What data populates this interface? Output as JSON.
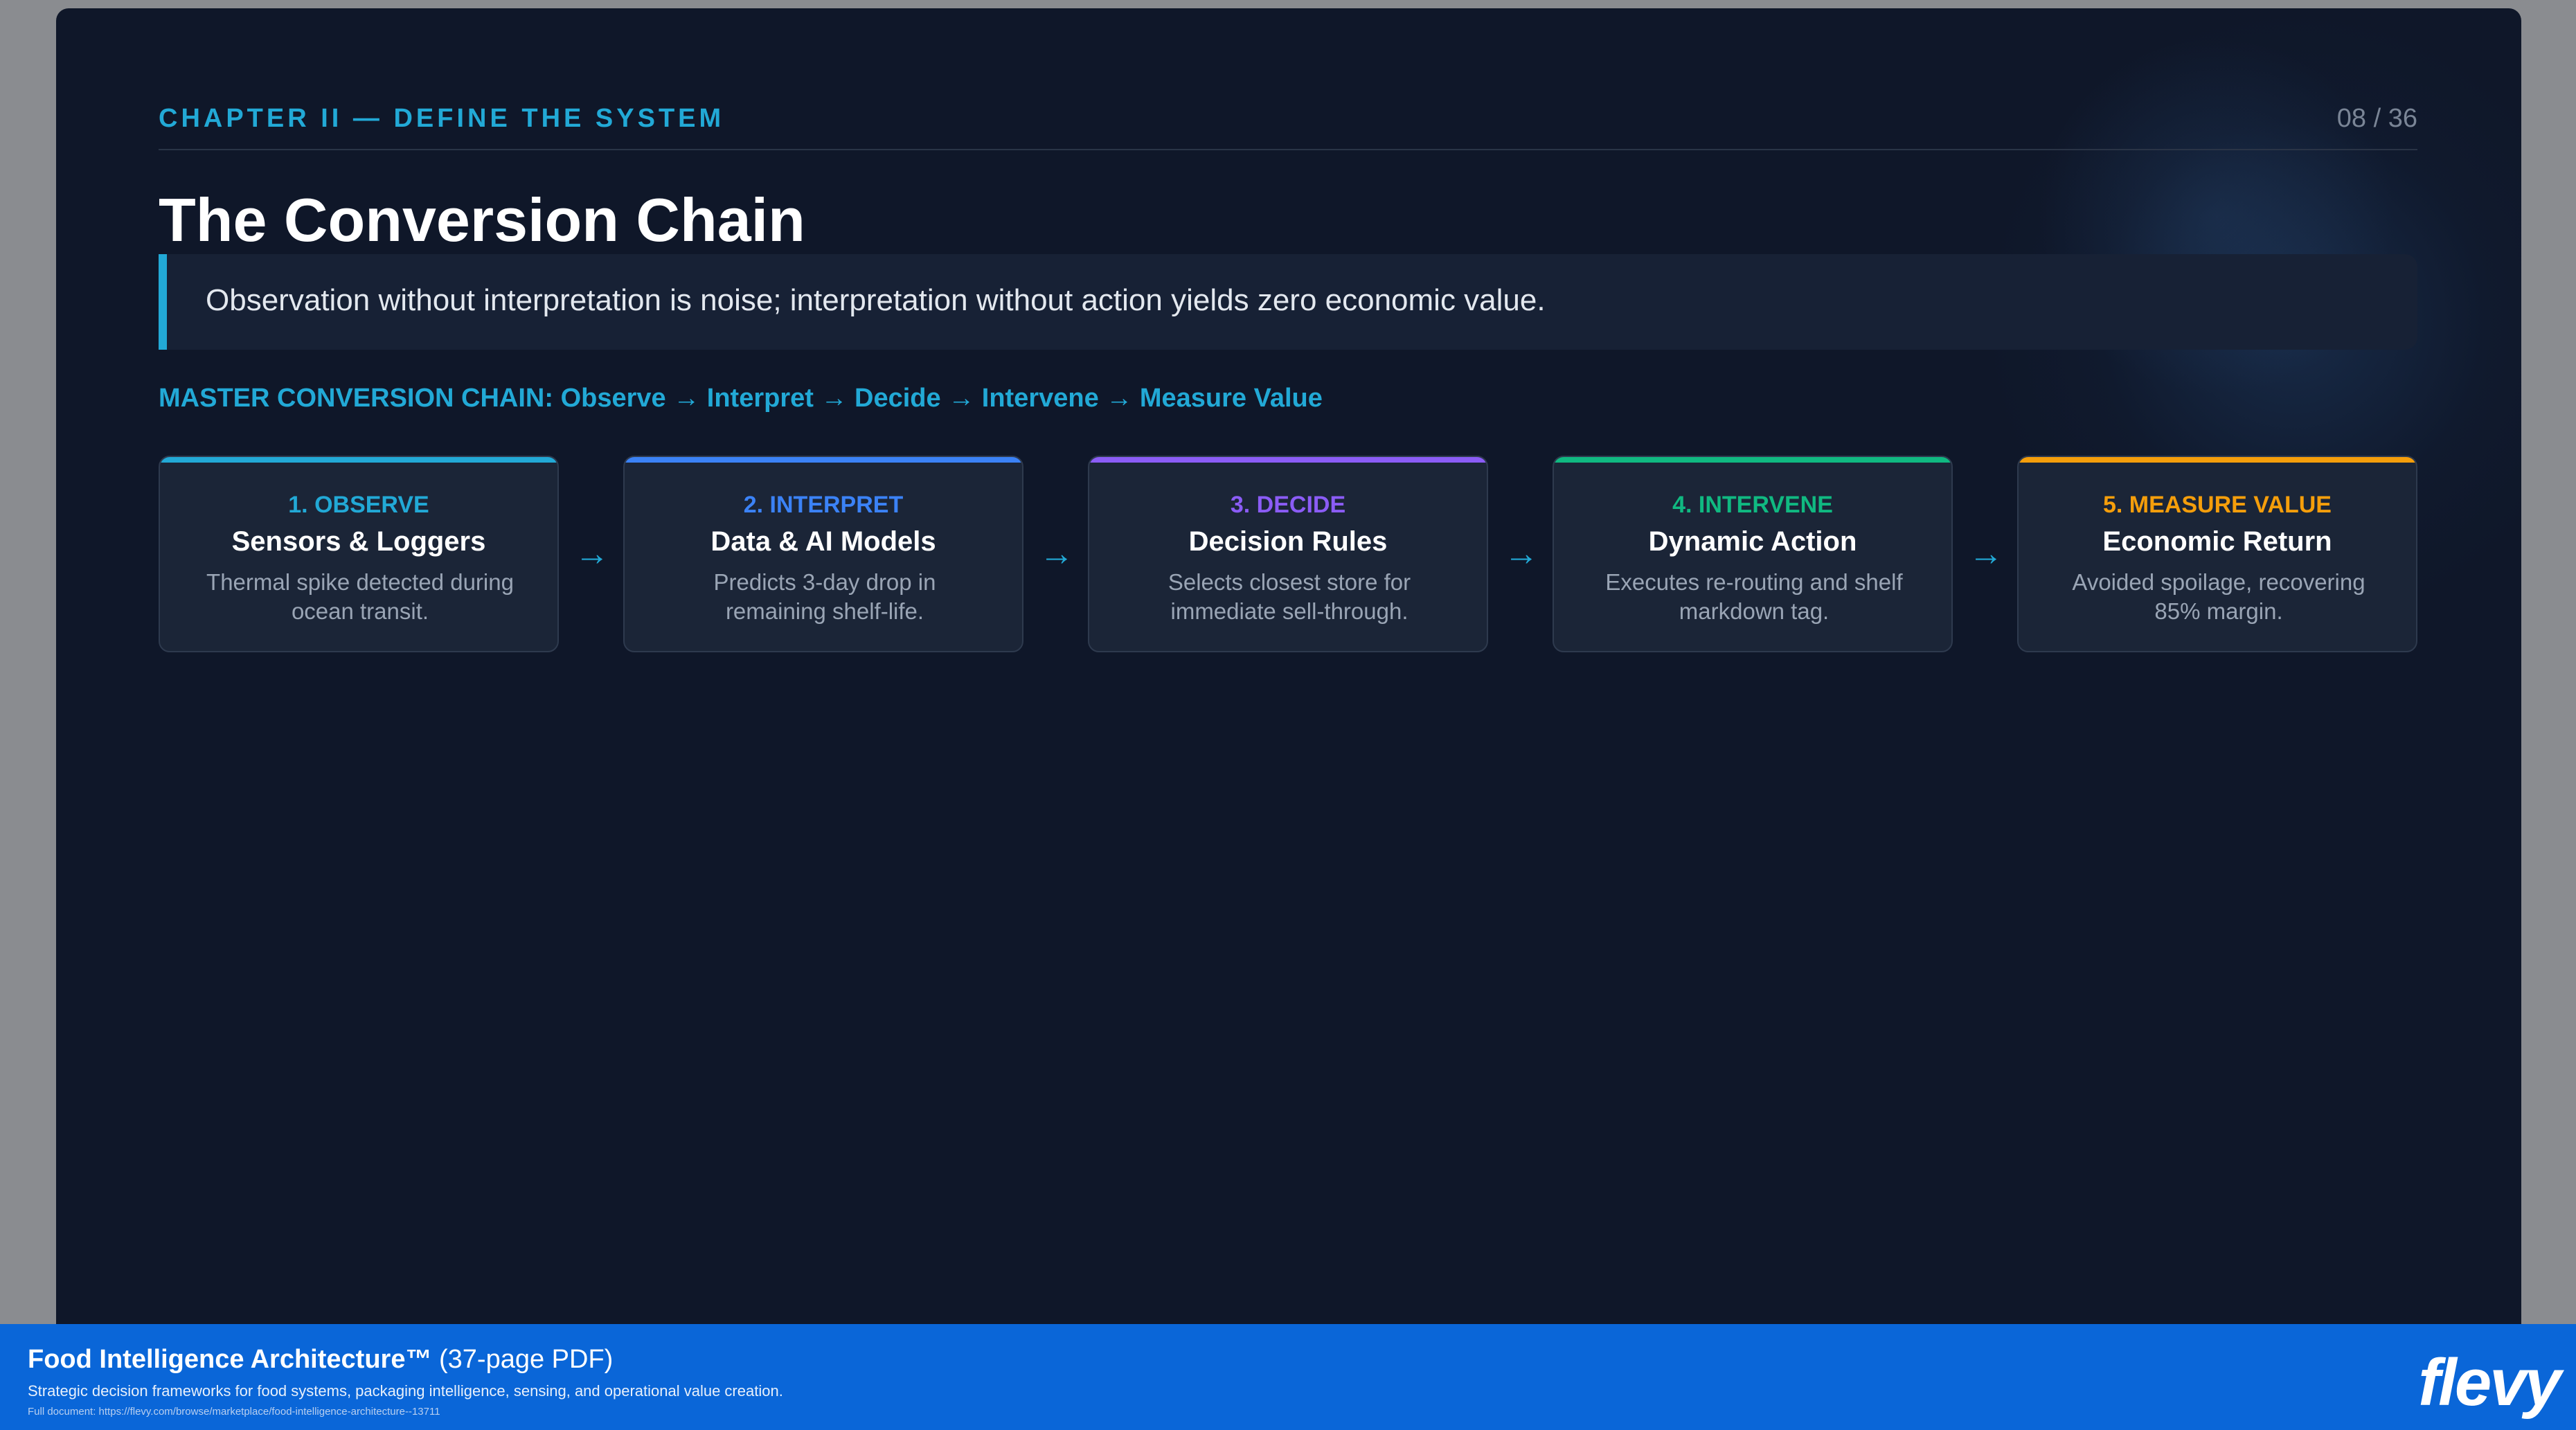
{
  "header": {
    "chapter": "CHAPTER II — DEFINE THE SYSTEM",
    "page_number": "08 / 36"
  },
  "title": "The Conversion Chain",
  "quote": "Observation without interpretation is noise; interpretation without action yields zero economic value.",
  "master_chain": "MASTER CONVERSION CHAIN: Observe → Interpret → Decide → Intervene → Measure Value",
  "steps": [
    {
      "step": "1. OBSERVE",
      "title": "Sensors & Loggers",
      "desc_line1": "Thermal spike detected during",
      "desc_line2": "ocean transit.",
      "color": "#22a9d6"
    },
    {
      "step": "2. INTERPRET",
      "title": "Data & AI Models",
      "desc_line1": "Predicts 3-day drop in",
      "desc_line2": "remaining shelf-life.",
      "color": "#3b82f6"
    },
    {
      "step": "3. DECIDE",
      "title": "Decision Rules",
      "desc_line1": "Selects closest store for",
      "desc_line2": "immediate sell-through.",
      "color": "#8b5cf6"
    },
    {
      "step": "4. INTERVENE",
      "title": "Dynamic Action",
      "desc_line1": "Executes re-routing and shelf",
      "desc_line2": "markdown tag.",
      "color": "#10b981"
    },
    {
      "step": "5. MEASURE VALUE",
      "title": "Economic Return",
      "desc_line1": "Avoided spoilage, recovering",
      "desc_line2": "85% margin.",
      "color": "#f59e0b"
    }
  ],
  "arrow_glyph": "→",
  "banner": {
    "title_bold": "Food Intelligence Architecture™",
    "title_rest": " (37-page PDF)",
    "subtitle": "Strategic decision frameworks for food systems, packaging intelligence, sensing, and operational value creation.",
    "url": "Full document: https://flevy.com/browse/marketplace/food-intelligence-architecture--13711",
    "logo": "flevy"
  }
}
